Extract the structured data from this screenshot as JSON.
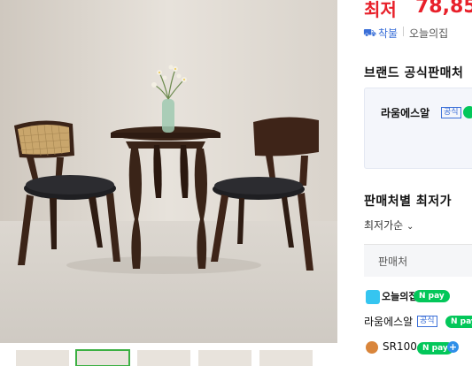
{
  "price": {
    "label": "최저",
    "value": "78,85"
  },
  "shipping": {
    "label": "착불",
    "mall": "오늘의집"
  },
  "official": {
    "title": "브랜드 공식판매처",
    "seller_name": "라움에스알",
    "badge": "공식"
  },
  "best_price": {
    "title": "판매처별 최저가",
    "sort_label": "최저가순",
    "column_seller": "판매처"
  },
  "sellers": [
    {
      "name": "오늘의집",
      "npay": "N pay",
      "icon": "home-icon"
    },
    {
      "name": "라움에스알",
      "badge": "공식",
      "npay": "N pay"
    },
    {
      "name": "SR100",
      "npay": "N pay",
      "extra": "+",
      "icon": "shop-icon"
    }
  ],
  "colors": {
    "accent_red": "#e8202a",
    "npay_green": "#03c75a",
    "link_blue": "#3a6fd8",
    "selected_thumb": "#3cb043"
  },
  "thumbnails": [
    {
      "selected": false
    },
    {
      "selected": true
    },
    {
      "selected": false
    },
    {
      "selected": false
    },
    {
      "selected": false
    }
  ]
}
